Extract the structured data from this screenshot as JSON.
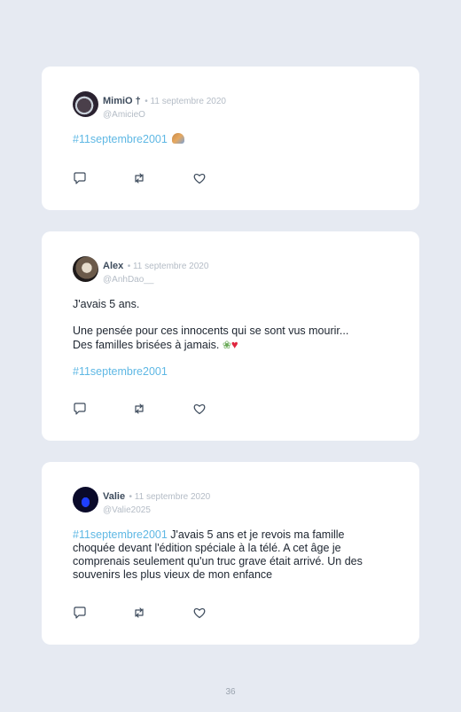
{
  "tweets": [
    {
      "name": "MimiO †",
      "date": "• 11 septembre 2020",
      "handle": "@AmicieO",
      "hashtag": "#11septembre2001",
      "text_after": "",
      "paragraphs": [],
      "emoji": "folded-hands"
    },
    {
      "name": "Alex",
      "date": "• 11 septembre 2020",
      "handle": "@AnhDao__",
      "p1": "J'avais 5 ans.",
      "p2a": "Une pensée pour ces innocents qui se sont vus mourir...",
      "p2b": "Des familles brisées à jamais.",
      "hashtag": "#11septembre2001",
      "emoji": "rose-heart"
    },
    {
      "name": "Valie",
      "date": "• 11 septembre 2020",
      "handle": "@Valie2025",
      "hashtag": "#11septembre2001",
      "text_after": " J'avais 5 ans et je revois ma famille choquée devant l'édition spéciale à la télé. A cet âge je comprenais seulement qu'un truc grave était arrivé. Un des souvenirs les plus vieux de mon enfance"
    }
  ],
  "icons": [
    "reply-icon",
    "retweet-icon",
    "like-icon"
  ],
  "page_number": "36",
  "colors": {
    "background": "#e6eaf2",
    "card": "#ffffff",
    "hashtag": "#5fb8e4",
    "name": "#3d4b5c",
    "muted": "#b4bcc6"
  }
}
